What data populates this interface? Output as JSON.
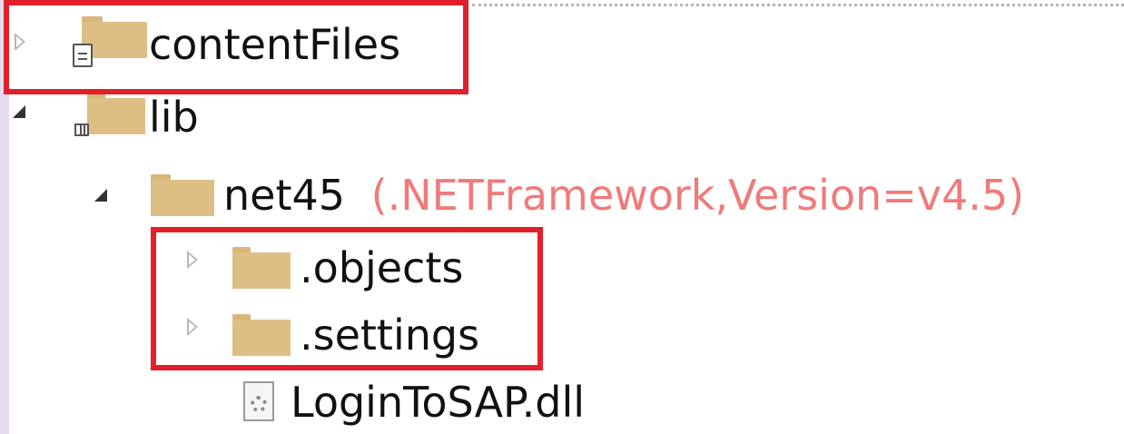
{
  "tree": {
    "items": [
      {
        "label": "contentFiles",
        "state": "collapsed",
        "icon": "folder-with-document-overlay-icon"
      },
      {
        "label": "lib",
        "state": "expanded",
        "icon": "folder-with-library-overlay-icon"
      },
      {
        "label": "net45",
        "suffix": "(.NETFramework,Version=v4.5)",
        "state": "expanded",
        "icon": "folder-icon"
      },
      {
        "label": ".objects",
        "state": "collapsed",
        "icon": "folder-icon"
      },
      {
        "label": ".settings",
        "state": "collapsed",
        "icon": "folder-icon"
      },
      {
        "label": "LoginToSAP.dll",
        "icon": "dll-file-icon"
      }
    ]
  },
  "colors": {
    "highlight": "#e2202b",
    "framework_text": "#f07a7a",
    "folder": "#ddbf86",
    "left_strip": "#e4ddef"
  }
}
